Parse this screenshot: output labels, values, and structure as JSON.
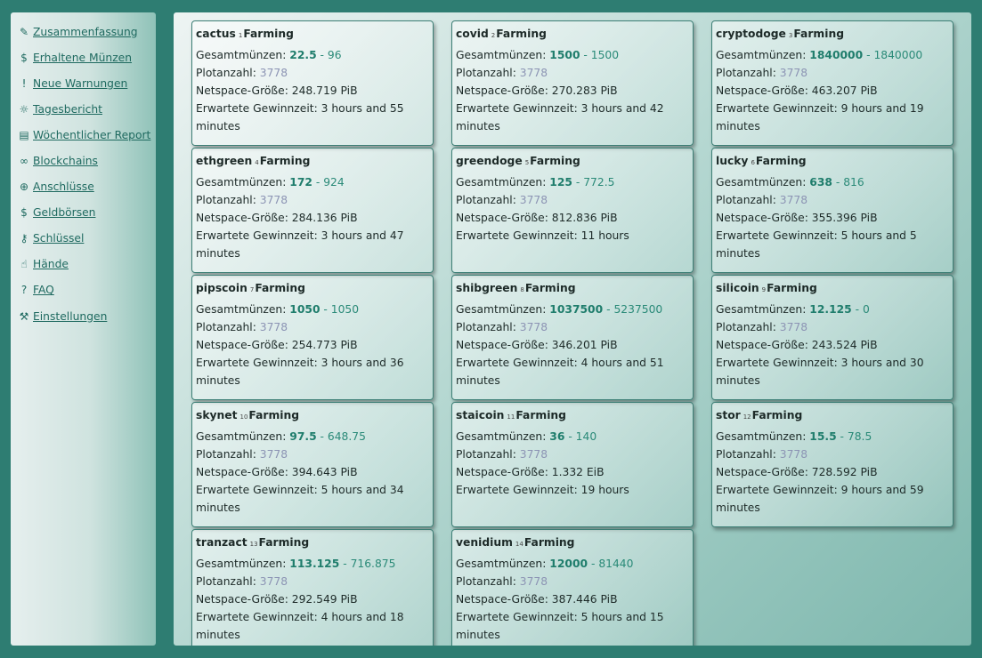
{
  "nav": {
    "items": [
      {
        "icon": "leaf-icon",
        "glyph": "✎",
        "label": "Zusammenfassung"
      },
      {
        "icon": "coin-icon",
        "glyph": "$",
        "label": "Erhaltene Münzen"
      },
      {
        "icon": "alert-icon",
        "glyph": "!",
        "label": "Neue Warnungen"
      },
      {
        "icon": "sun-icon",
        "glyph": "☼",
        "label": "Tagesbericht"
      },
      {
        "icon": "calendar-icon",
        "glyph": "▤",
        "label": "Wöchentlicher Report"
      },
      {
        "icon": "link-icon",
        "glyph": "∞",
        "label": "Blockchains"
      },
      {
        "icon": "globe-icon",
        "glyph": "⊕",
        "label": "Anschlüsse"
      },
      {
        "icon": "wallet-icon",
        "glyph": "$",
        "label": "Geldbörsen"
      },
      {
        "icon": "key-icon",
        "glyph": "⚷",
        "label": "Schlüssel"
      },
      {
        "icon": "hand-icon",
        "glyph": "☝",
        "label": "Hände"
      },
      {
        "icon": "faq-icon",
        "glyph": "?",
        "label": "FAQ"
      },
      {
        "icon": "wrench-icon",
        "glyph": "⚒",
        "label": "Einstellungen"
      }
    ]
  },
  "labels": {
    "coins": "Gesamtmünzen:",
    "plots": "Plotanzahl:",
    "netspace": "Netspace-Größe:",
    "eta": "Erwartete Gewinnzeit:",
    "sep": " - "
  },
  "cards": [
    {
      "name": "cactus",
      "index": "1",
      "status": "Farming",
      "coins": "22.5",
      "coins_alt": "96",
      "plots": "3778",
      "netspace": "248.719 PiB",
      "eta": "3 hours and 55 minutes"
    },
    {
      "name": "covid",
      "index": "2",
      "status": "Farming",
      "coins": "1500",
      "coins_alt": "1500",
      "plots": "3778",
      "netspace": "270.283 PiB",
      "eta": "3 hours and 42 minutes"
    },
    {
      "name": "cryptodoge",
      "index": "3",
      "status": "Farming",
      "coins": "1840000",
      "coins_alt": "1840000",
      "plots": "3778",
      "netspace": "463.207 PiB",
      "eta": "9 hours and 19 minutes"
    },
    {
      "name": "ethgreen",
      "index": "4",
      "status": "Farming",
      "coins": "172",
      "coins_alt": "924",
      "plots": "3778",
      "netspace": "284.136 PiB",
      "eta": "3 hours and 47 minutes"
    },
    {
      "name": "greendoge",
      "index": "5",
      "status": "Farming",
      "coins": "125",
      "coins_alt": "772.5",
      "plots": "3778",
      "netspace": "812.836 PiB",
      "eta": "11 hours"
    },
    {
      "name": "lucky",
      "index": "6",
      "status": "Farming",
      "coins": "638",
      "coins_alt": "816",
      "plots": "3778",
      "netspace": "355.396 PiB",
      "eta": "5 hours and 5 minutes"
    },
    {
      "name": "pipscoin",
      "index": "7",
      "status": "Farming",
      "coins": "1050",
      "coins_alt": "1050",
      "plots": "3778",
      "netspace": "254.773 PiB",
      "eta": "3 hours and 36 minutes"
    },
    {
      "name": "shibgreen",
      "index": "8",
      "status": "Farming",
      "coins": "1037500",
      "coins_alt": "5237500",
      "plots": "3778",
      "netspace": "346.201 PiB",
      "eta": "4 hours and 51 minutes"
    },
    {
      "name": "silicoin",
      "index": "9",
      "status": "Farming",
      "coins": "12.125",
      "coins_alt": "0",
      "plots": "3778",
      "netspace": "243.524 PiB",
      "eta": "3 hours and 30 minutes"
    },
    {
      "name": "skynet",
      "index": "10",
      "status": "Farming",
      "coins": "97.5",
      "coins_alt": "648.75",
      "plots": "3778",
      "netspace": "394.643 PiB",
      "eta": "5 hours and 34 minutes"
    },
    {
      "name": "staicoin",
      "index": "11",
      "status": "Farming",
      "coins": "36",
      "coins_alt": "140",
      "plots": "3778",
      "netspace": "1.332 EiB",
      "eta": "19 hours"
    },
    {
      "name": "stor",
      "index": "12",
      "status": "Farming",
      "coins": "15.5",
      "coins_alt": "78.5",
      "plots": "3778",
      "netspace": "728.592 PiB",
      "eta": "9 hours and 59 minutes"
    },
    {
      "name": "tranzact",
      "index": "13",
      "status": "Farming",
      "coins": "113.125",
      "coins_alt": "716.875",
      "plots": "3778",
      "netspace": "292.549 PiB",
      "eta": "4 hours and 18 minutes"
    },
    {
      "name": "venidium",
      "index": "14",
      "status": "Farming",
      "coins": "12000",
      "coins_alt": "81440",
      "plots": "3778",
      "netspace": "387.446 PiB",
      "eta": "5 hours and 15 minutes"
    }
  ]
}
